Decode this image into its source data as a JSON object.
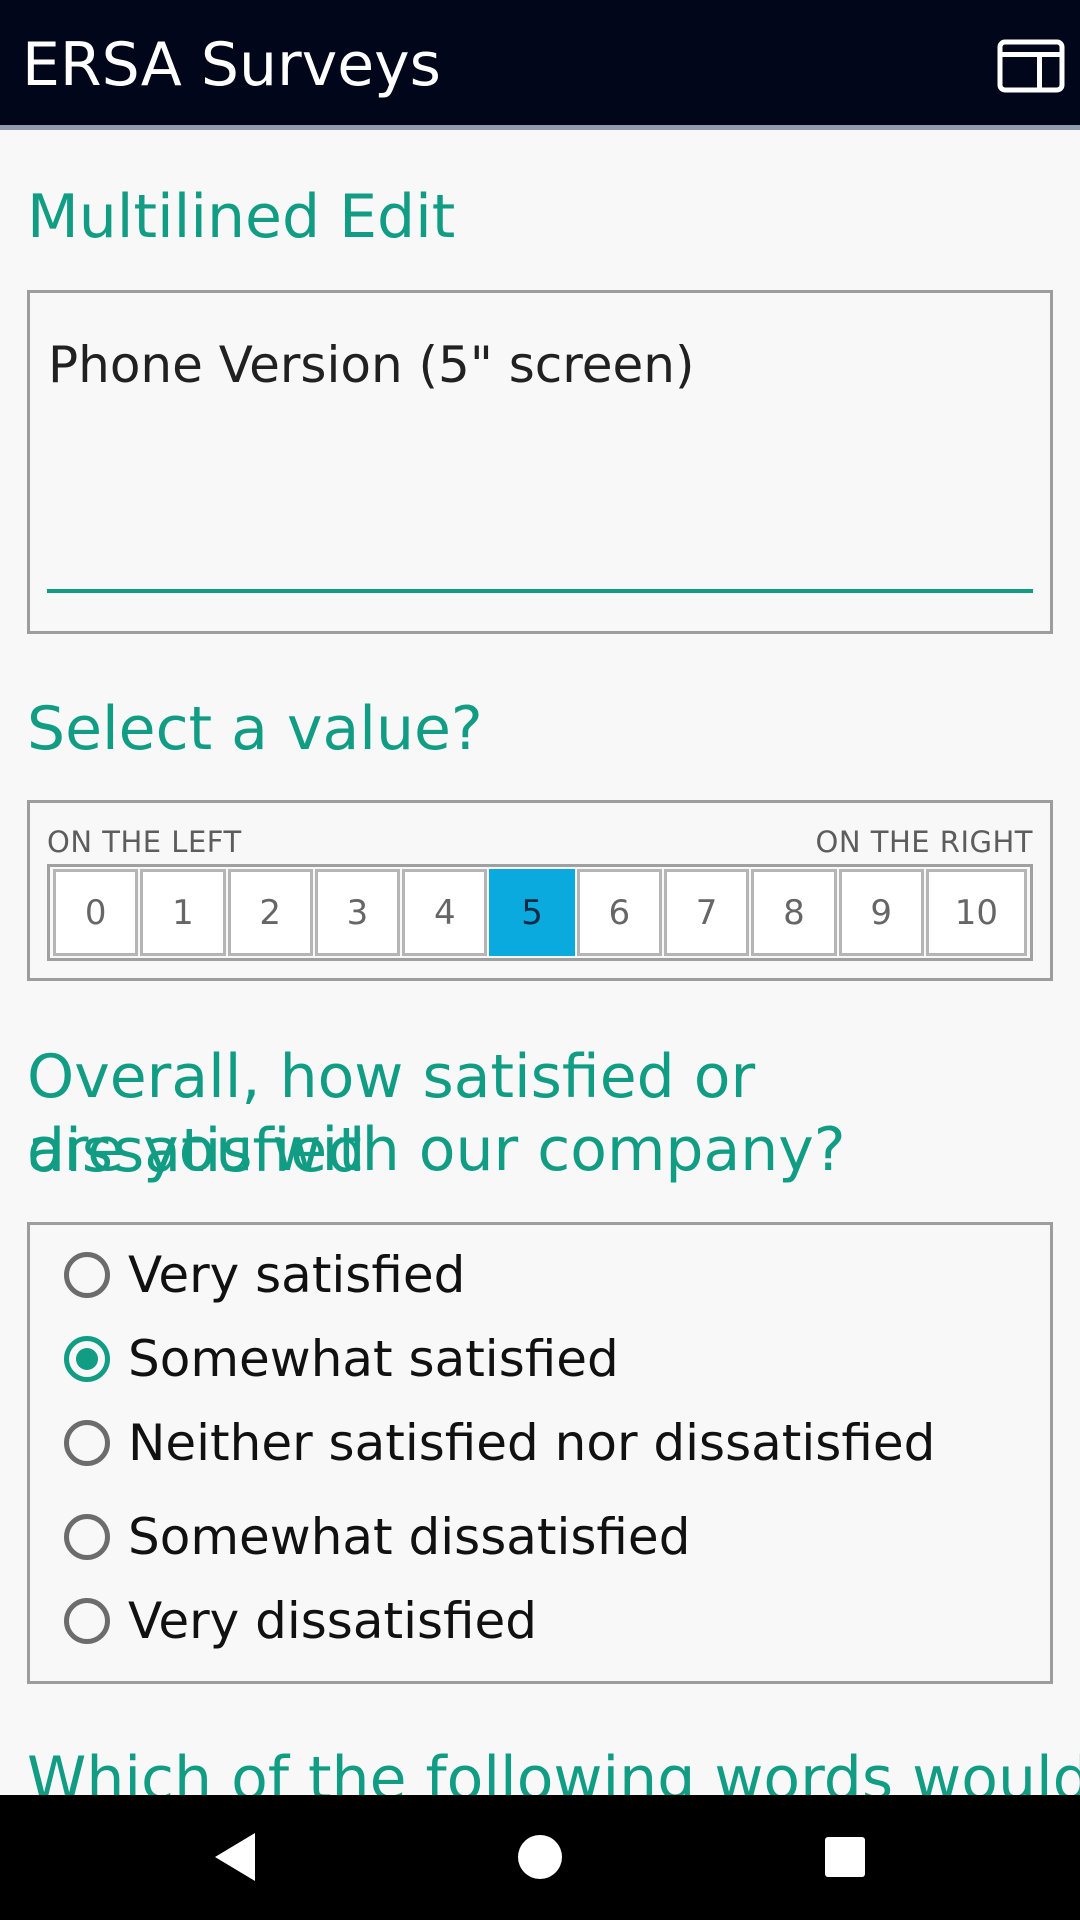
{
  "appbar": {
    "title": "ERSA Surveys"
  },
  "q1": {
    "title": "Multilined Edit",
    "value": "Phone Version (5\" screen)"
  },
  "q2": {
    "title": "Select a value?",
    "left_label": "ON THE LEFT",
    "right_label": "ON THE RIGHT",
    "options": [
      "0",
      "1",
      "2",
      "3",
      "4",
      "5",
      "6",
      "7",
      "8",
      "9",
      "10"
    ],
    "selected": "5"
  },
  "q3": {
    "title_line1": "Overall, how satisfied or dissatisfied",
    "title_line2": "are you with our company?",
    "options": [
      "Very satisfied",
      "Somewhat satisfied",
      "Neither satisfied nor dissatisfied",
      "Somewhat dissatisfied",
      "Very dissatisfied"
    ],
    "selected": "Somewhat satisfied"
  },
  "q4": {
    "title_partial": "Which of the following words would"
  },
  "colors": {
    "accent": "#119c84",
    "selected_cell": "#0aa9de",
    "appbar": "#02061a"
  }
}
